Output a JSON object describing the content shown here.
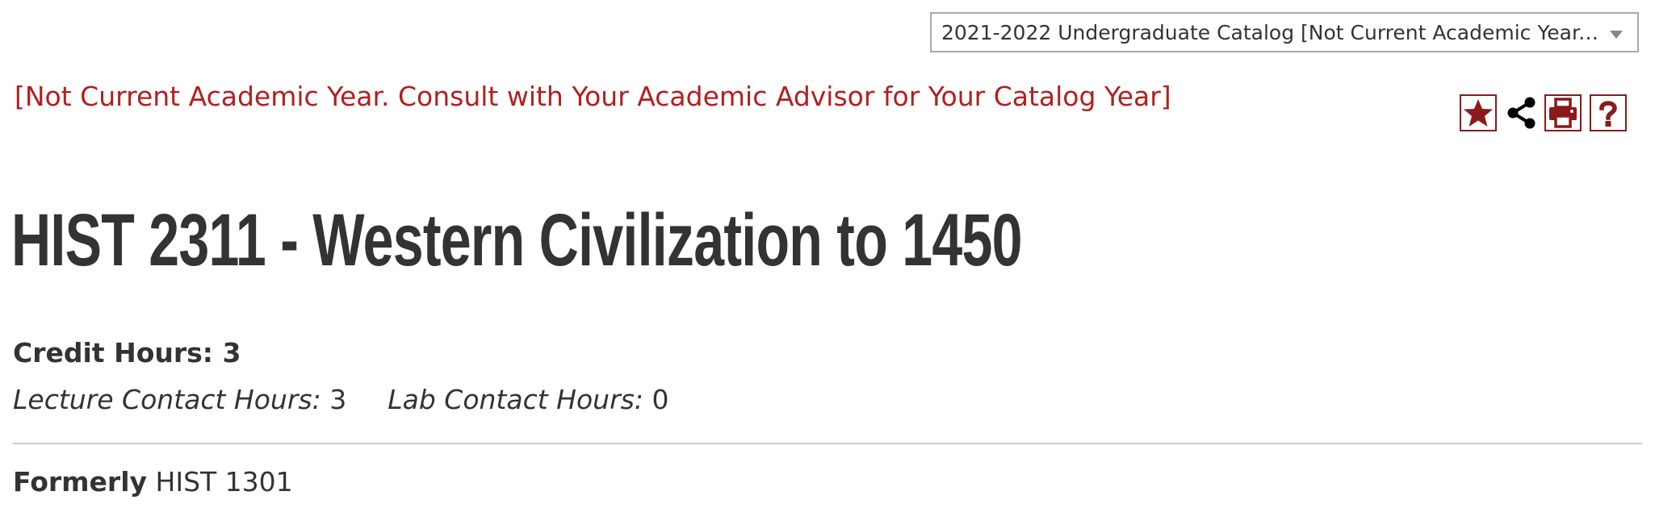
{
  "catalog_select": {
    "selected": "2021-2022 Undergraduate Catalog [Not Current Academic Year. Cons..."
  },
  "notice": "[Not Current Academic Year. Consult with Your Academic Advisor for Your Catalog Year]",
  "toolbar": {
    "icons": [
      "star-icon",
      "share-icon",
      "print-icon",
      "help-icon"
    ]
  },
  "course": {
    "title": "HIST 2311 -  Western Civilization to 1450",
    "credit_hours_label": "Credit Hours:",
    "credit_hours_value": "3",
    "lecture_label": "Lecture Contact Hours:",
    "lecture_value": "3",
    "lab_label": "Lab Contact Hours:",
    "lab_value": "0",
    "formerly_label": "Formerly",
    "formerly_value": "HIST 1301"
  },
  "colors": {
    "accent": "#b21f1f",
    "icon": "#8b1a1a",
    "text": "#333333"
  }
}
